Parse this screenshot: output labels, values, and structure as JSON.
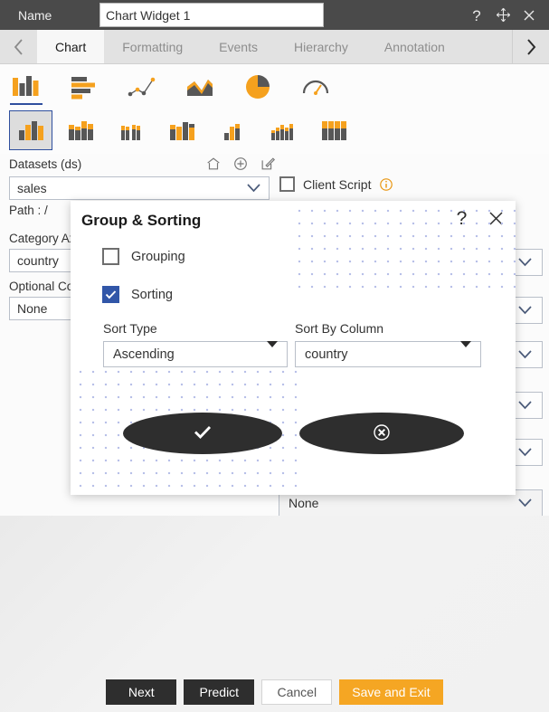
{
  "titlebar": {
    "name_label": "Name",
    "widget_name": "Chart Widget 1",
    "widget_name_placeholder": "Chart Widget 1",
    "help_icon": "question-mark-icon",
    "move_icon": "move-icon",
    "close_icon": "close-icon"
  },
  "tabs": {
    "prev_icon": "chevron-left-icon",
    "next_icon": "chevron-right-icon",
    "items": [
      {
        "label": "Chart",
        "active": true
      },
      {
        "label": "Formatting",
        "active": false
      },
      {
        "label": "Events",
        "active": false
      },
      {
        "label": "Hierarchy",
        "active": false
      },
      {
        "label": "Annotation",
        "active": false
      }
    ]
  },
  "chart_types": {
    "row1": [
      {
        "name": "column-chart-icon",
        "selected": true
      },
      {
        "name": "bar-chart-icon",
        "selected": false
      },
      {
        "name": "scatter-line-chart-icon",
        "selected": false
      },
      {
        "name": "area-chart-icon",
        "selected": false
      },
      {
        "name": "pie-chart-icon",
        "selected": false
      },
      {
        "name": "gauge-chart-icon",
        "selected": false
      }
    ],
    "row2": [
      {
        "name": "clustered-column-icon",
        "selected": true
      },
      {
        "name": "stacked-column-icon",
        "selected": false
      },
      {
        "name": "stacked-column-grouped-icon",
        "selected": false
      },
      {
        "name": "mixed-column-icon",
        "selected": false
      },
      {
        "name": "small-column-icon",
        "selected": false
      },
      {
        "name": "waterfall-column-icon",
        "selected": false
      },
      {
        "name": "full-stacked-column-icon",
        "selected": false
      }
    ]
  },
  "panel": {
    "datasets_label": "Datasets (ds)",
    "datasets_value": "sales",
    "home_icon": "home-icon",
    "add_icon": "plus-circle-icon",
    "edit_icon": "edit-pencil-icon",
    "client_script_label": "Client Script",
    "client_script_checked": false,
    "client_script_info_icon": "info-icon",
    "path_label": "Path :  /",
    "category_label": "Category Axis",
    "category_value": "country",
    "optional_label": "Optional Column",
    "optional_value": "None",
    "chevron_icon": "chevron-down-icon",
    "cursor_icon": "cursor-arrow-icon",
    "bottom_select_value": "None"
  },
  "modal": {
    "title": "Group & Sorting",
    "help_icon": "question-mark-icon",
    "close_icon": "close-icon",
    "grouping_label": "Grouping",
    "grouping_checked": false,
    "sorting_label": "Sorting",
    "sorting_checked": true,
    "sort_type_label": "Sort Type",
    "sort_type_value": "Ascending",
    "sort_by_label": "Sort By Column",
    "sort_by_value": "country",
    "confirm_icon": "check-icon",
    "cancel_icon": "x-circle-icon",
    "caret_icon": "caret-down-icon"
  },
  "footer": {
    "next": "Next",
    "predict": "Predict",
    "cancel": "Cancel",
    "save_exit": "Save and Exit"
  },
  "colors": {
    "accent_orange": "#f5a623",
    "chart_orange": "#f5a11e",
    "chart_gray": "#575757",
    "select_blue": "#3156a8",
    "titlebar": "#4a4a4a",
    "dark_button": "#2e2e2e"
  }
}
